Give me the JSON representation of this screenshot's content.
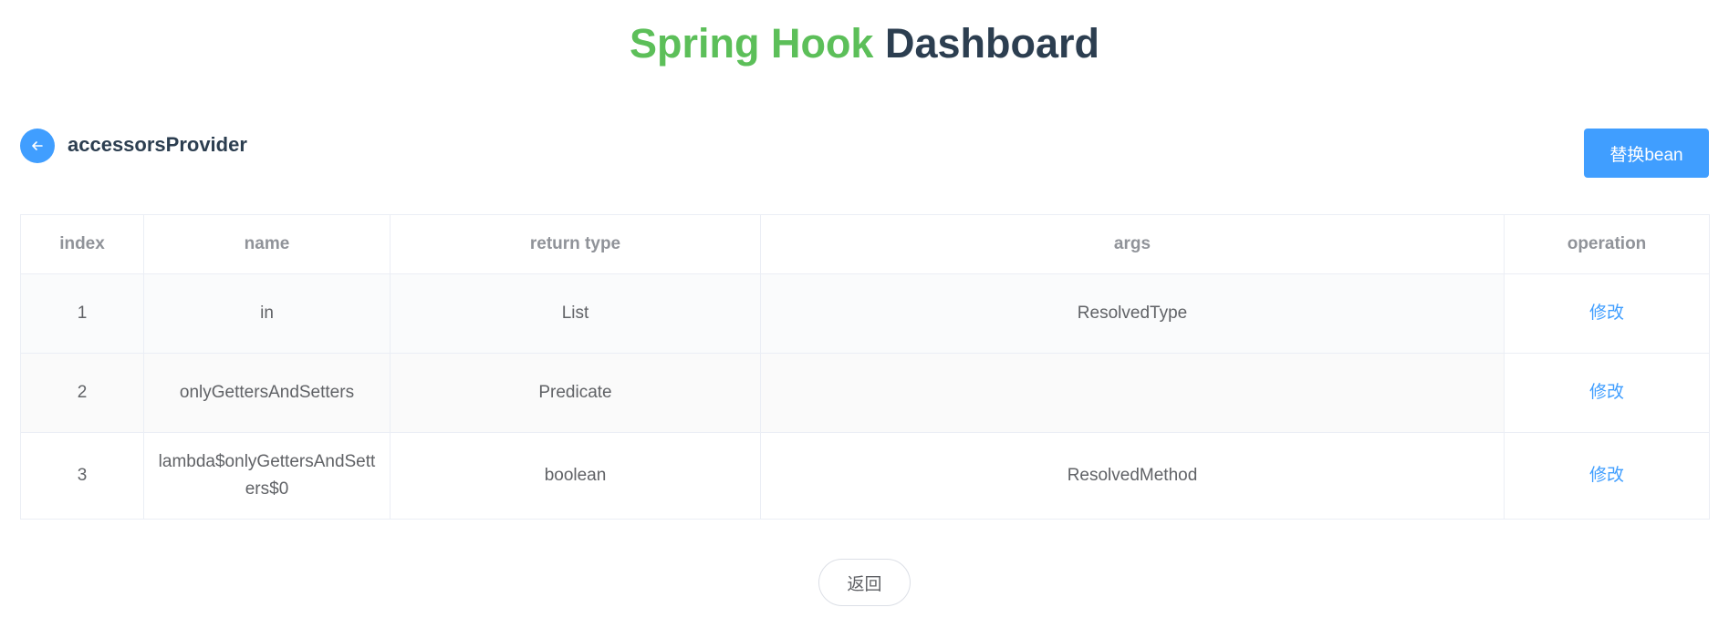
{
  "header": {
    "title_green": "Spring Hook",
    "title_dark": "Dashboard"
  },
  "bean": {
    "name": "accessorsProvider",
    "back_icon": "arrow-left-icon",
    "replace_label": "替换bean"
  },
  "table": {
    "columns": [
      "index",
      "name",
      "return type",
      "args",
      "operation"
    ],
    "rows": [
      {
        "index": "1",
        "name": "in",
        "return_type": "List",
        "args": "ResolvedType",
        "operation": "修改"
      },
      {
        "index": "2",
        "name": "onlyGettersAndSetters",
        "return_type": "Predicate",
        "args": "",
        "operation": "修改"
      },
      {
        "index": "3",
        "name": "lambda$onlyGettersAndSetters$0",
        "return_type": "boolean",
        "args": "ResolvedMethod",
        "operation": "修改"
      }
    ]
  },
  "footer": {
    "return_label": "返回"
  },
  "colors": {
    "accent": "#409eff",
    "title_green": "#5cbf59",
    "title_dark": "#2c3e50"
  }
}
